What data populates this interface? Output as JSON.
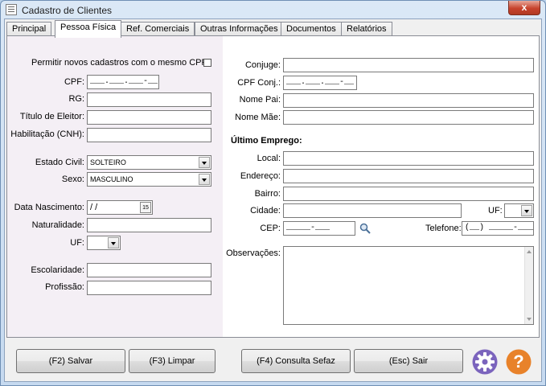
{
  "window": {
    "title": "Cadastro de Clientes",
    "close_glyph": "x"
  },
  "tabs": [
    "Principal",
    "Pessoa Física",
    "Ref. Comerciais",
    "Outras Informações",
    "Documentos",
    "Relatórios"
  ],
  "left": {
    "permitir_label": "Permitir novos cadastros com o mesmo CPF:",
    "cpf_label": "CPF:",
    "cpf_value": "___.___.___-__",
    "rg_label": "RG:",
    "titulo_label": "Título de Eleitor:",
    "cnh_label": "Habilitação (CNH):",
    "estado_civil_label": "Estado Civil:",
    "estado_civil_value": "SOLTEIRO",
    "sexo_label": "Sexo:",
    "sexo_value": "MASCULINO",
    "nascimento_label": "Data Nascimento:",
    "nascimento_value": " / /",
    "calendar_label": "15",
    "naturalidade_label": "Naturalidade:",
    "uf_label": "UF:",
    "escolaridade_label": "Escolaridade:",
    "profissao_label": "Profissão:"
  },
  "right": {
    "conjuge_label": "Conjuge:",
    "cpf_conj_label": "CPF Conj.:",
    "cpf_conj_value": "___.___.___-__",
    "nome_pai_label": "Nome Pai:",
    "nome_mae_label": "Nome Mãe:",
    "ultimo_emprego_title": "Último Emprego:",
    "local_label": "Local:",
    "endereco_label": "Endereço:",
    "bairro_label": "Bairro:",
    "cidade_label": "Cidade:",
    "uf_label": "UF:",
    "cep_label": "CEP:",
    "cep_value": "_____-___",
    "telefone_label": "Telefone:",
    "telefone_value": "(__) _____-____",
    "observacoes_label": "Observações:"
  },
  "buttons": {
    "salvar": "(F2) Salvar",
    "limpar": "(F3) Limpar",
    "consulta": "(F4) Consulta Sefaz",
    "sair": "(Esc) Sair"
  },
  "icons": {
    "settings": "gear-icon",
    "help": "help-icon",
    "help_glyph": "?"
  },
  "colors": {
    "icon_purple": "#7b64bd",
    "icon_orange": "#e8822a",
    "panel_bg": "#f4eff5"
  }
}
